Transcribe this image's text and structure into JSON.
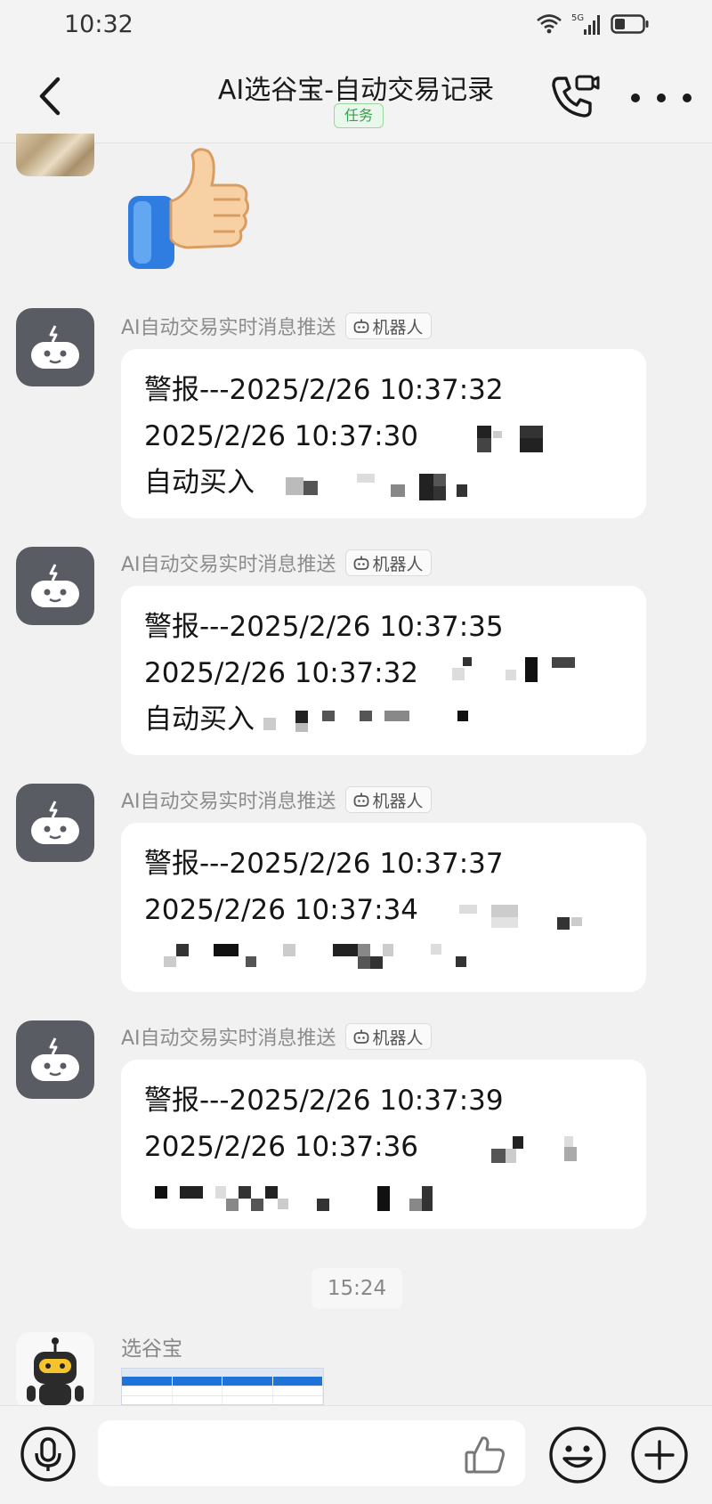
{
  "status_bar": {
    "time": "10:32",
    "network": "5G"
  },
  "header": {
    "title": "AI选谷宝-自动交易记录",
    "badge": "任务"
  },
  "bot": {
    "name": "AI自动交易实时消息推送",
    "tag": "机器人"
  },
  "messages": [
    {
      "line1": "警报---2025/2/26 10:37:32",
      "line2": "2025/2/26 10:37:30",
      "line3": "自动买入"
    },
    {
      "line1": "警报---2025/2/26 10:37:35",
      "line2": "2025/2/26 10:37:32",
      "line3": "自动买入"
    },
    {
      "line1": "警报---2025/2/26 10:37:37",
      "line2": "2025/2/26 10:37:34",
      "line3": ""
    },
    {
      "line1": "警报---2025/2/26 10:37:39",
      "line2": "2025/2/26 10:37:36",
      "line3": ""
    }
  ],
  "time_divider": "15:24",
  "last_sender": {
    "name": "选谷宝"
  },
  "input": {
    "placeholder": ""
  }
}
